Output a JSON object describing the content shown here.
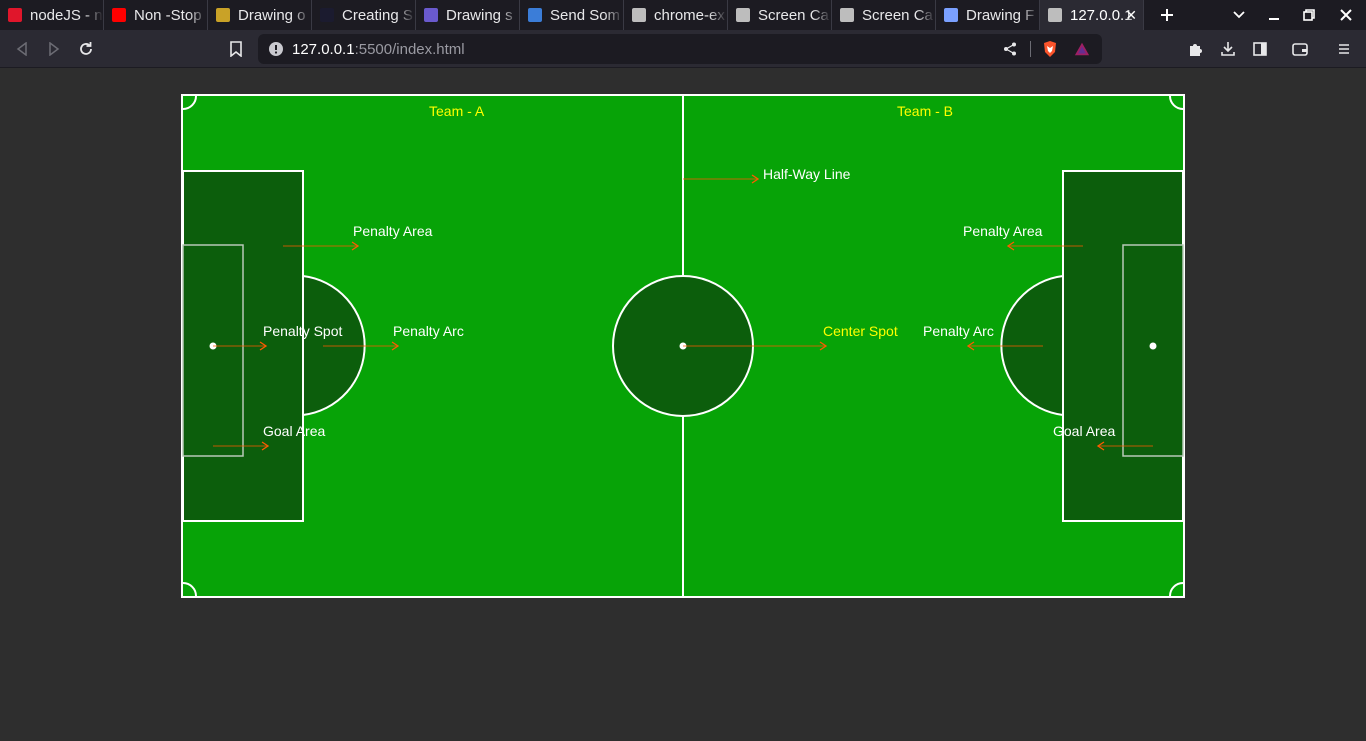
{
  "browser": {
    "tabs": [
      {
        "title": "nodeJS - n",
        "icon": "red-n-icon",
        "color": "#e0162b"
      },
      {
        "title": "Non -Stop",
        "icon": "youtube-icon",
        "color": "#ff0000"
      },
      {
        "title": "Drawing o",
        "icon": "ejs-icon",
        "color": "#c9a227"
      },
      {
        "title": "Creating S",
        "icon": "f-icon",
        "color": "#1b1b2f"
      },
      {
        "title": "Drawing s",
        "icon": "colorful-icon",
        "color": "#6a5acd"
      },
      {
        "title": "Send Som",
        "icon": "globe-icon",
        "color": "#3b7dd8"
      },
      {
        "title": "chrome-ex",
        "icon": "camera-icon",
        "color": "#bdbdbd"
      },
      {
        "title": "Screen Ca",
        "icon": "camera-icon",
        "color": "#bdbdbd"
      },
      {
        "title": "Screen Ca",
        "icon": "camera-icon",
        "color": "#bdbdbd"
      },
      {
        "title": "Drawing F",
        "icon": "drawing-icon",
        "color": "#7aa0ff"
      },
      {
        "title": "127.0.0.1",
        "icon": "globe-icon",
        "color": "#bdbdbd",
        "active": true
      }
    ],
    "url": {
      "host": "127.0.0.1",
      "rest": ":5500/index.html"
    }
  },
  "pitch": {
    "colors": {
      "grass": "#07a307",
      "dark": "#0c5e0c",
      "line": "#ffffff",
      "arrow": "#ff5a00",
      "team_label": "#ffff00",
      "center_label": "#ffff00",
      "label": "#ffffff"
    },
    "team_a": "Team - A",
    "team_b": "Team - B",
    "labels": {
      "half_way_line": "Half-Way Line",
      "penalty_area_left": "Penalty Area",
      "penalty_area_right": "Penalty Area",
      "penalty_spot": "Penalty Spot",
      "penalty_arc_left": "Penalty Arc",
      "penalty_arc_right": "Penalty Arc",
      "center_spot": "Center Spot",
      "goal_area_left": "Goal Area",
      "goal_area_right": "Goal Area"
    }
  }
}
